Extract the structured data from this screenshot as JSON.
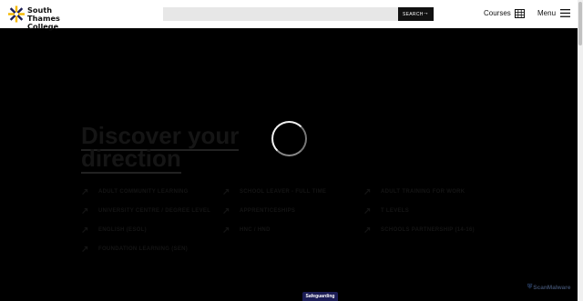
{
  "brand": {
    "name": "South Thames\nCollege",
    "colors": {
      "mark_yellow": "#f5b800",
      "mark_dark": "#1b1c55"
    }
  },
  "search": {
    "placeholder": "",
    "button_label": "SEARCH",
    "button_icon": "arrow-right-icon"
  },
  "nav": {
    "courses_label": "Courses",
    "courses_icon": "grid-icon",
    "menu_label": "Menu",
    "menu_icon": "hamburger-icon"
  },
  "hero": {
    "title_line1": "Discover your",
    "title_line2": "direction"
  },
  "course_links": [
    {
      "label": "ADULT COMMUNITY LEARNING"
    },
    {
      "label": "SCHOOL LEAVER - FULL TIME"
    },
    {
      "label": "ADULT TRAINING FOR WORK"
    },
    {
      "label": "UNIVERSITY CENTRE / DEGREE LEVEL"
    },
    {
      "label": "APPRENTICESHIPS"
    },
    {
      "label": "T LEVELS"
    },
    {
      "label": "ENGLISH (ESOL)"
    },
    {
      "label": "HNC / HND"
    },
    {
      "label": "SCHOOLS PARTNERSHIP (14-16)"
    },
    {
      "label": "FOUNDATION LEARNING (SEN)"
    }
  ],
  "footer": {
    "safeguarding_label": "Safeguarding",
    "scanmalware_label": "ScanMalware"
  },
  "loading": {
    "state": "spinner-visible"
  }
}
